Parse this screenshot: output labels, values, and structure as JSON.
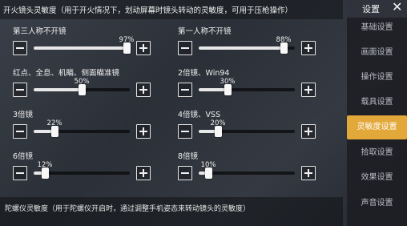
{
  "header": {
    "title": "开火镜头灵敏度（用于开火情况下，划动屏幕时镜头转动的灵敏度，可用于压枪操作）"
  },
  "sliders": [
    {
      "label": "第三人称不开镜",
      "value": "97%",
      "fraction": 0.97
    },
    {
      "label": "第一人称不开镜",
      "value": "88%",
      "fraction": 0.88
    },
    {
      "label": "红点、全息、机瞄、侧面瞄准镜",
      "value": "50%",
      "fraction": 0.5
    },
    {
      "label": "2倍镜、Win94",
      "value": "30%",
      "fraction": 0.3
    },
    {
      "label": "3倍镜",
      "value": "22%",
      "fraction": 0.22
    },
    {
      "label": "4倍镜、VSS",
      "value": "20%",
      "fraction": 0.2
    },
    {
      "label": "6倍镜",
      "value": "12%",
      "fraction": 0.12
    },
    {
      "label": "8倍镜",
      "value": "10%",
      "fraction": 0.1
    }
  ],
  "footer": {
    "text": "陀螺仪灵敏度（用于陀螺仪开启时，通过调整手机姿态来转动镜头的灵敏度）"
  },
  "sidebar": {
    "title": "设置",
    "close": "✕",
    "items": [
      {
        "label": "基础设置",
        "active": false
      },
      {
        "label": "画面设置",
        "active": false
      },
      {
        "label": "操作设置",
        "active": false
      },
      {
        "label": "载具设置",
        "active": false
      },
      {
        "label": "灵敏度设置",
        "active": true
      },
      {
        "label": "拾取设置",
        "active": false
      },
      {
        "label": "效果设置",
        "active": false
      },
      {
        "label": "声音设置",
        "active": false
      }
    ]
  },
  "colors": {
    "accent": "#e2a83a",
    "track": "#0a0a0c",
    "fill": "#e8e8e8"
  },
  "icons": {
    "minus": "minus-icon",
    "plus": "plus-icon",
    "close": "close-icon"
  }
}
